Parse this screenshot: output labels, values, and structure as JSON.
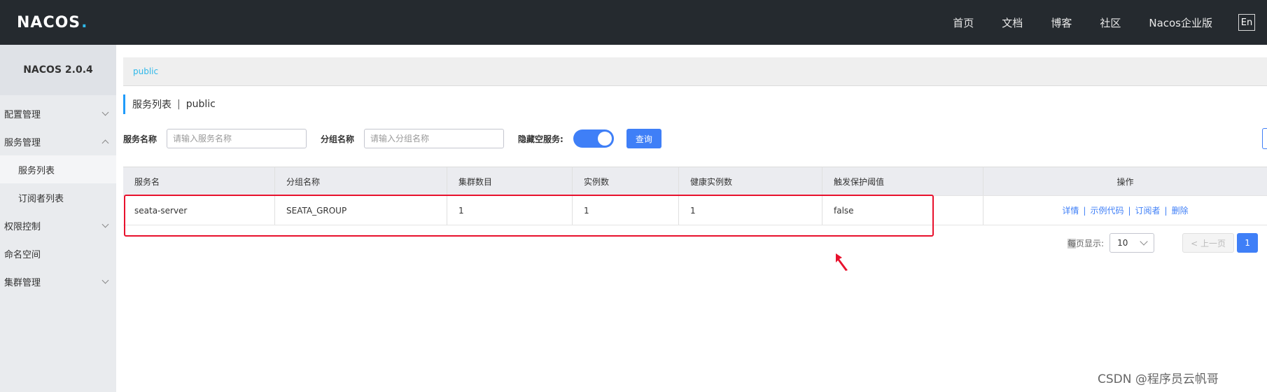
{
  "header": {
    "logo_text": "NACOS",
    "nav": [
      "首页",
      "文档",
      "博客",
      "社区",
      "Nacos企业版"
    ],
    "lang_button": "En"
  },
  "sidebar": {
    "brand": "NACOS 2.0.4",
    "items": [
      {
        "label": "配置管理"
      },
      {
        "label": "服务管理"
      },
      {
        "label": "服务列表"
      },
      {
        "label": "订阅者列表"
      },
      {
        "label": "权限控制"
      },
      {
        "label": "命名空间"
      },
      {
        "label": "集群管理"
      }
    ]
  },
  "namespace_bar": {
    "link": "public"
  },
  "page_title": {
    "title": "服务列表",
    "separator": "|",
    "namespace": "public"
  },
  "filter": {
    "service_name_label": "服务名称",
    "service_name_placeholder": "请输入服务名称",
    "group_name_label": "分组名称",
    "group_name_placeholder": "请输入分组名称",
    "hide_empty_label": "隐藏空服务:",
    "hide_empty_on": true,
    "query_button": "查询"
  },
  "table": {
    "headers": [
      "服务名",
      "分组名称",
      "集群数目",
      "实例数",
      "健康实例数",
      "触发保护阈值",
      "操作"
    ],
    "rows": [
      {
        "service": "seata-server",
        "group": "SEATA_GROUP",
        "clusters": "1",
        "instances": "1",
        "healthy": "1",
        "threshold": "false",
        "ops": [
          "详情",
          "示例代码",
          "订阅者",
          "删除"
        ]
      }
    ]
  },
  "pagination": {
    "per_page_label_first": "每",
    "per_page_label_rest": "页显示:",
    "per_page_value": "10",
    "prev": "< 上一页",
    "current_page": "1"
  },
  "watermark": "CSDN @程序员云帆哥",
  "colors": {
    "accent": "#3f7ff7",
    "highlight": "#e8112d",
    "header_bg": "#252a2f",
    "link": "#2fb8e9"
  }
}
